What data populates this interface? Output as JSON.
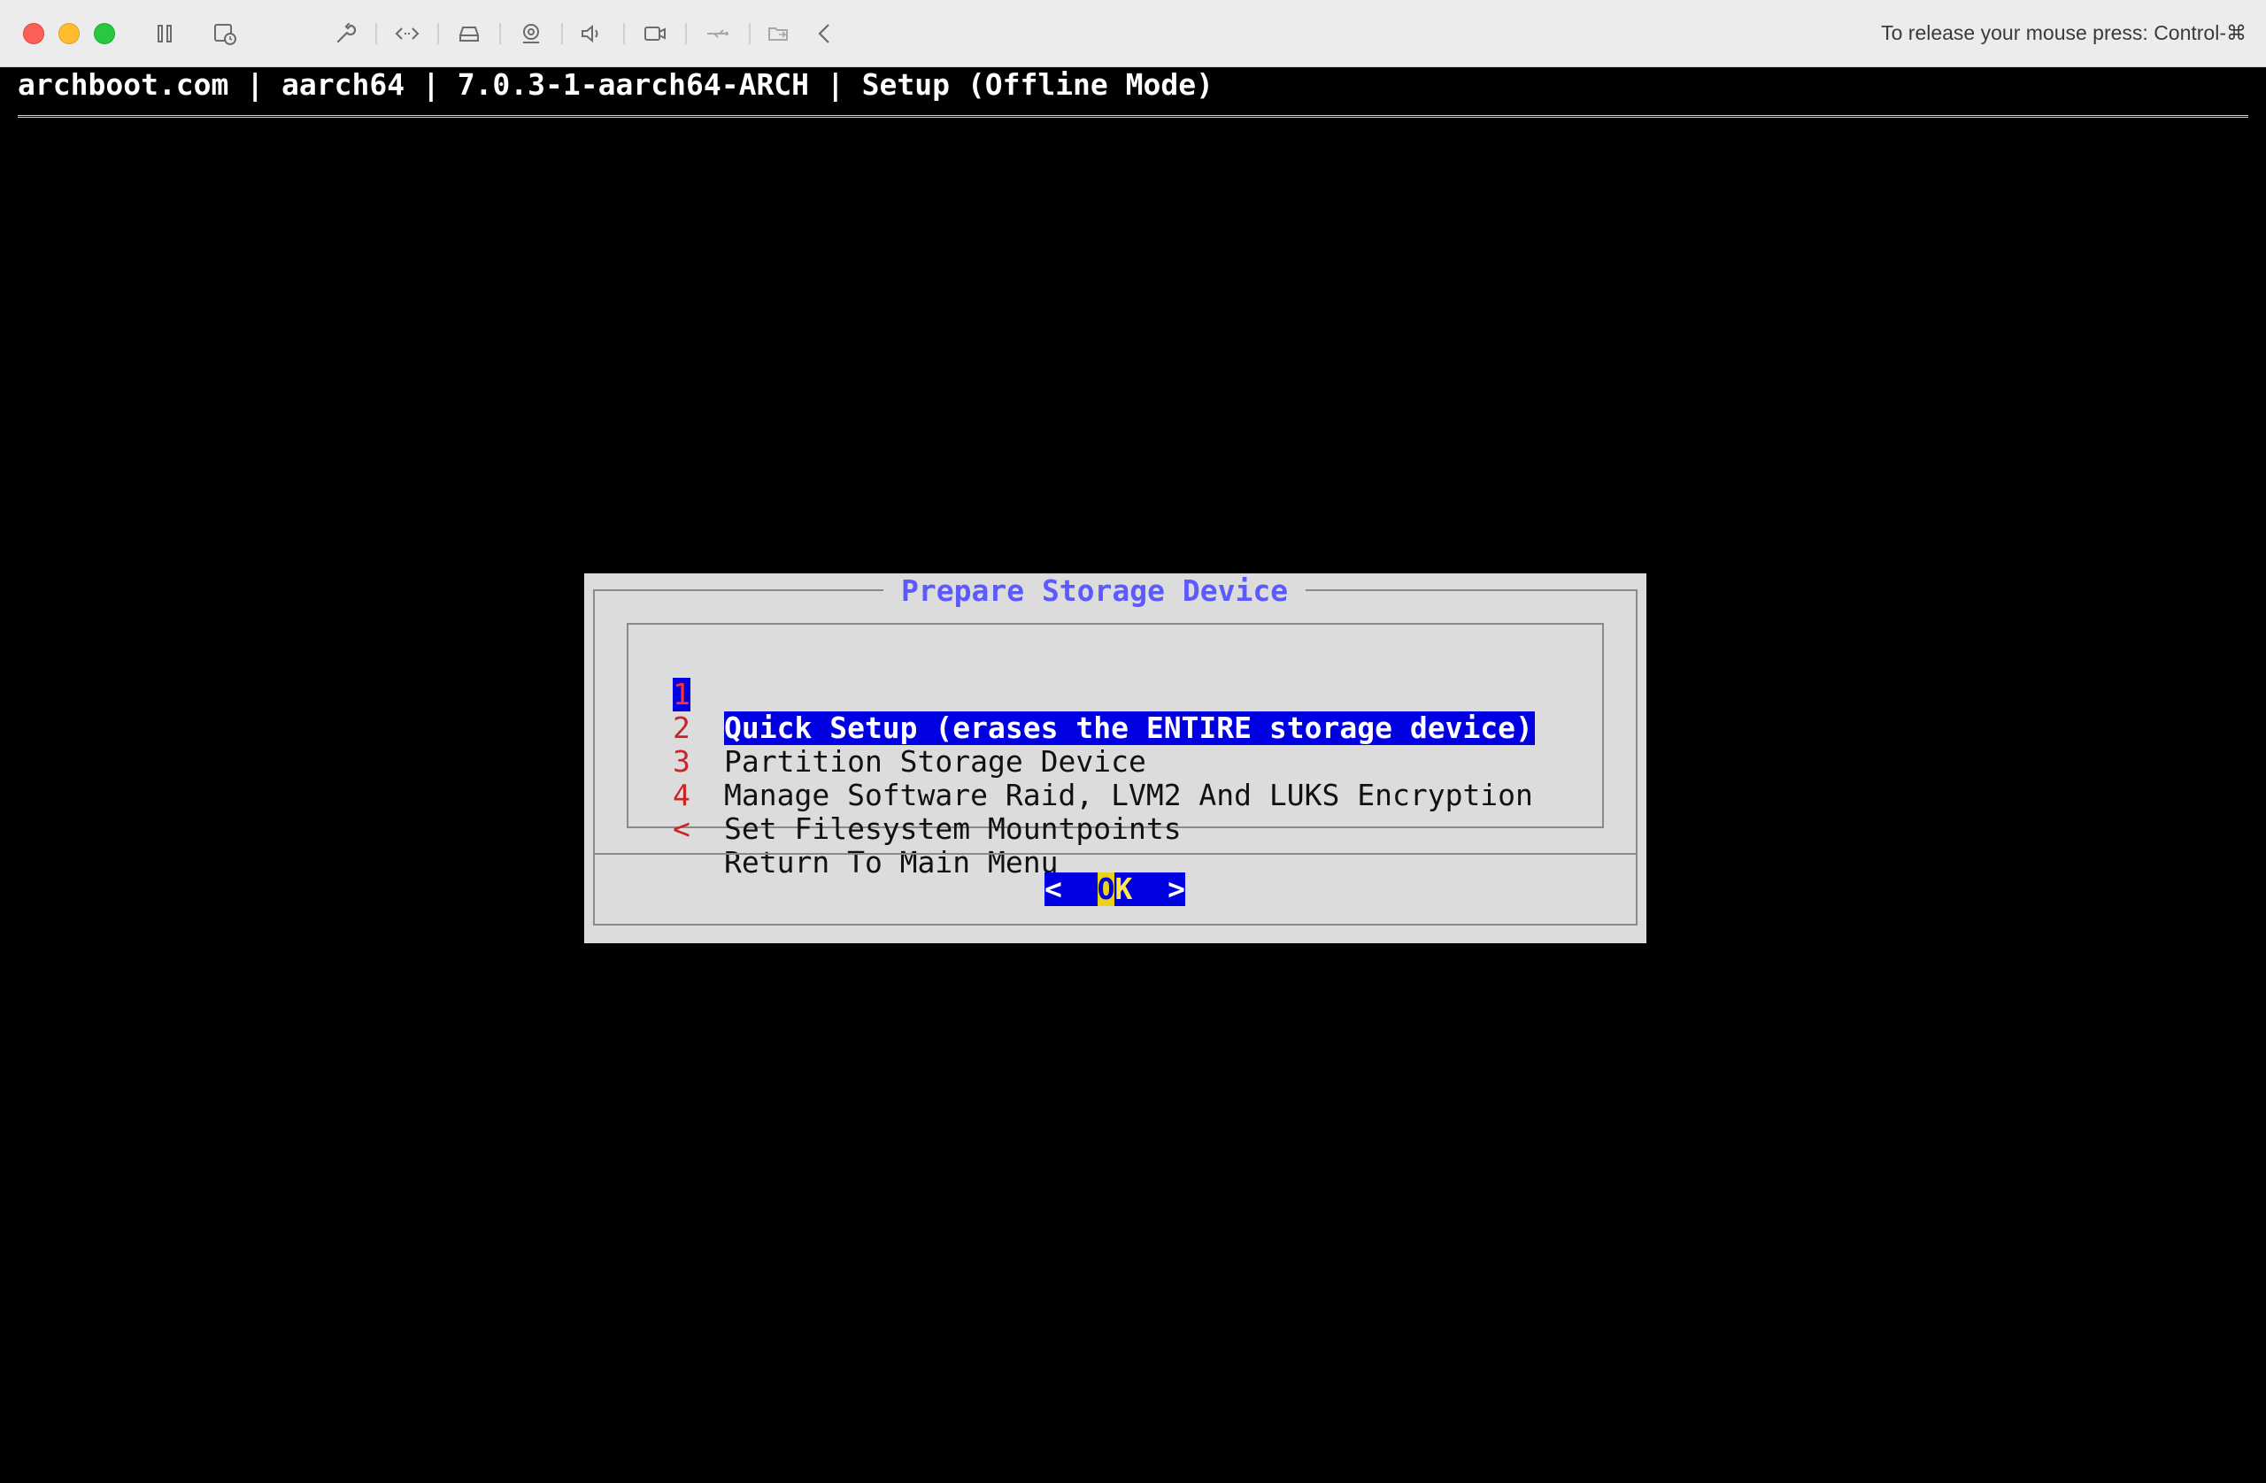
{
  "toolbar": {
    "release_message": "To release your mouse press: Control-⌘",
    "icons": [
      "pause-icon",
      "snapshot-icon",
      "settings-wrench-icon",
      "code-arrows-icon",
      "drive-icon",
      "camera-capture-icon",
      "speaker-icon",
      "video-camera-icon",
      "usb-icon",
      "shared-folder-icon",
      "chevron-left-icon"
    ]
  },
  "terminal": {
    "header": "archboot.com | aarch64 | 7.0.3-1-aarch64-ARCH | Setup (Offline Mode)"
  },
  "dialog": {
    "title": "Prepare Storage Device",
    "items": [
      {
        "key": "1",
        "label": "Quick Setup (erases the ENTIRE storage device)",
        "selected": true
      },
      {
        "key": "2",
        "label": "Partition Storage Device",
        "selected": false
      },
      {
        "key": "3",
        "label": "Manage Software Raid, LVM2 And LUKS Encryption",
        "selected": false
      },
      {
        "key": "4",
        "label": "Set Filesystem Mountpoints",
        "selected": false
      },
      {
        "key": "<",
        "label": "Return To Main Menu",
        "selected": false
      }
    ],
    "ok_button": {
      "left": "<  ",
      "hotkey": "O",
      "rest": "K",
      "right": "  >"
    }
  },
  "colors": {
    "selection_bg": "#0000e0",
    "title_color": "#5a5aff",
    "key_color": "#c8242a",
    "dialog_bg": "#dcdcdc"
  }
}
